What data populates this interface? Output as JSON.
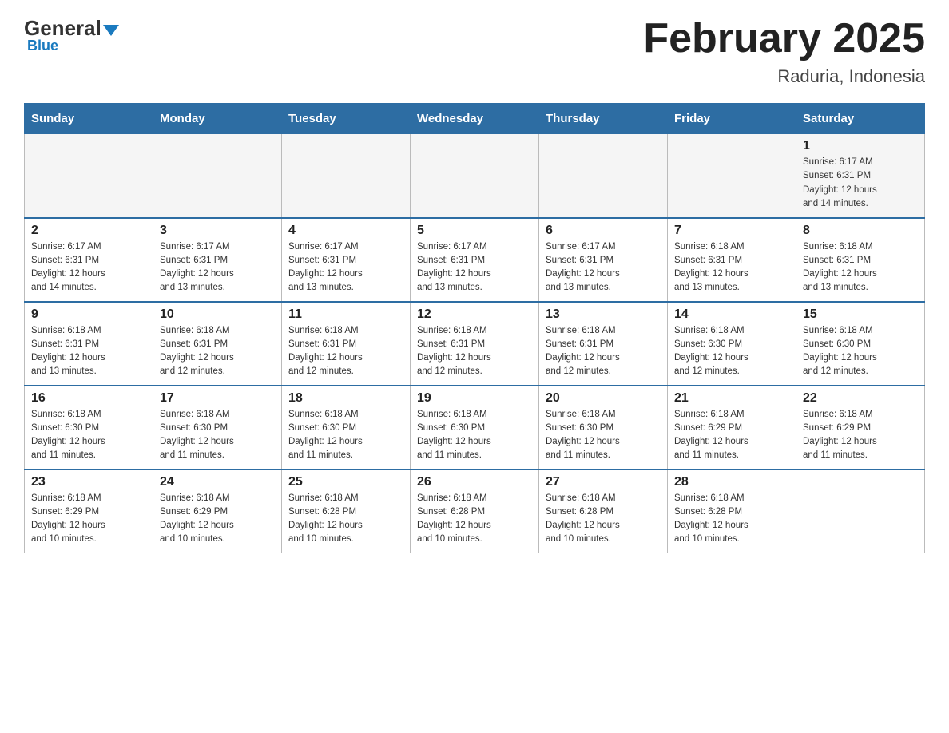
{
  "header": {
    "logo_general": "General",
    "logo_blue": "Blue",
    "month_title": "February 2025",
    "location": "Raduria, Indonesia"
  },
  "days_of_week": [
    "Sunday",
    "Monday",
    "Tuesday",
    "Wednesday",
    "Thursday",
    "Friday",
    "Saturday"
  ],
  "weeks": [
    {
      "days": [
        {
          "num": "",
          "info": ""
        },
        {
          "num": "",
          "info": ""
        },
        {
          "num": "",
          "info": ""
        },
        {
          "num": "",
          "info": ""
        },
        {
          "num": "",
          "info": ""
        },
        {
          "num": "",
          "info": ""
        },
        {
          "num": "1",
          "info": "Sunrise: 6:17 AM\nSunset: 6:31 PM\nDaylight: 12 hours\nand 14 minutes."
        }
      ]
    },
    {
      "days": [
        {
          "num": "2",
          "info": "Sunrise: 6:17 AM\nSunset: 6:31 PM\nDaylight: 12 hours\nand 14 minutes."
        },
        {
          "num": "3",
          "info": "Sunrise: 6:17 AM\nSunset: 6:31 PM\nDaylight: 12 hours\nand 13 minutes."
        },
        {
          "num": "4",
          "info": "Sunrise: 6:17 AM\nSunset: 6:31 PM\nDaylight: 12 hours\nand 13 minutes."
        },
        {
          "num": "5",
          "info": "Sunrise: 6:17 AM\nSunset: 6:31 PM\nDaylight: 12 hours\nand 13 minutes."
        },
        {
          "num": "6",
          "info": "Sunrise: 6:17 AM\nSunset: 6:31 PM\nDaylight: 12 hours\nand 13 minutes."
        },
        {
          "num": "7",
          "info": "Sunrise: 6:18 AM\nSunset: 6:31 PM\nDaylight: 12 hours\nand 13 minutes."
        },
        {
          "num": "8",
          "info": "Sunrise: 6:18 AM\nSunset: 6:31 PM\nDaylight: 12 hours\nand 13 minutes."
        }
      ]
    },
    {
      "days": [
        {
          "num": "9",
          "info": "Sunrise: 6:18 AM\nSunset: 6:31 PM\nDaylight: 12 hours\nand 13 minutes."
        },
        {
          "num": "10",
          "info": "Sunrise: 6:18 AM\nSunset: 6:31 PM\nDaylight: 12 hours\nand 12 minutes."
        },
        {
          "num": "11",
          "info": "Sunrise: 6:18 AM\nSunset: 6:31 PM\nDaylight: 12 hours\nand 12 minutes."
        },
        {
          "num": "12",
          "info": "Sunrise: 6:18 AM\nSunset: 6:31 PM\nDaylight: 12 hours\nand 12 minutes."
        },
        {
          "num": "13",
          "info": "Sunrise: 6:18 AM\nSunset: 6:31 PM\nDaylight: 12 hours\nand 12 minutes."
        },
        {
          "num": "14",
          "info": "Sunrise: 6:18 AM\nSunset: 6:30 PM\nDaylight: 12 hours\nand 12 minutes."
        },
        {
          "num": "15",
          "info": "Sunrise: 6:18 AM\nSunset: 6:30 PM\nDaylight: 12 hours\nand 12 minutes."
        }
      ]
    },
    {
      "days": [
        {
          "num": "16",
          "info": "Sunrise: 6:18 AM\nSunset: 6:30 PM\nDaylight: 12 hours\nand 11 minutes."
        },
        {
          "num": "17",
          "info": "Sunrise: 6:18 AM\nSunset: 6:30 PM\nDaylight: 12 hours\nand 11 minutes."
        },
        {
          "num": "18",
          "info": "Sunrise: 6:18 AM\nSunset: 6:30 PM\nDaylight: 12 hours\nand 11 minutes."
        },
        {
          "num": "19",
          "info": "Sunrise: 6:18 AM\nSunset: 6:30 PM\nDaylight: 12 hours\nand 11 minutes."
        },
        {
          "num": "20",
          "info": "Sunrise: 6:18 AM\nSunset: 6:30 PM\nDaylight: 12 hours\nand 11 minutes."
        },
        {
          "num": "21",
          "info": "Sunrise: 6:18 AM\nSunset: 6:29 PM\nDaylight: 12 hours\nand 11 minutes."
        },
        {
          "num": "22",
          "info": "Sunrise: 6:18 AM\nSunset: 6:29 PM\nDaylight: 12 hours\nand 11 minutes."
        }
      ]
    },
    {
      "days": [
        {
          "num": "23",
          "info": "Sunrise: 6:18 AM\nSunset: 6:29 PM\nDaylight: 12 hours\nand 10 minutes."
        },
        {
          "num": "24",
          "info": "Sunrise: 6:18 AM\nSunset: 6:29 PM\nDaylight: 12 hours\nand 10 minutes."
        },
        {
          "num": "25",
          "info": "Sunrise: 6:18 AM\nSunset: 6:28 PM\nDaylight: 12 hours\nand 10 minutes."
        },
        {
          "num": "26",
          "info": "Sunrise: 6:18 AM\nSunset: 6:28 PM\nDaylight: 12 hours\nand 10 minutes."
        },
        {
          "num": "27",
          "info": "Sunrise: 6:18 AM\nSunset: 6:28 PM\nDaylight: 12 hours\nand 10 minutes."
        },
        {
          "num": "28",
          "info": "Sunrise: 6:18 AM\nSunset: 6:28 PM\nDaylight: 12 hours\nand 10 minutes."
        },
        {
          "num": "",
          "info": ""
        }
      ]
    }
  ]
}
